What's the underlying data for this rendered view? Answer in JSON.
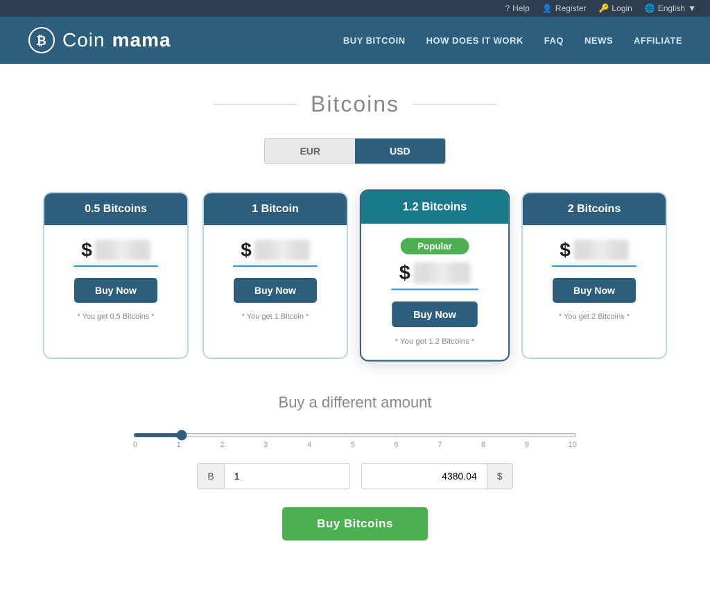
{
  "topbar": {
    "help": "Help",
    "register": "Register",
    "login": "Login",
    "language": "English"
  },
  "header": {
    "logo": "Coinmama",
    "nav": [
      "BUY BITCOIN",
      "HOW DOES IT WORK",
      "FAQ",
      "NEWS",
      "AFFILIATE"
    ]
  },
  "main": {
    "title": "Bitcoins",
    "currency_eur": "EUR",
    "currency_usd": "USD",
    "cards": [
      {
        "amount": "0.5 Bitcoins",
        "price_symbol": "$",
        "you_get": "* You get 0.5 Bitcoins *",
        "btn": "Buy Now",
        "featured": false,
        "popular": false
      },
      {
        "amount": "1 Bitcoin",
        "price_symbol": "$",
        "you_get": "* You get 1 Bitcoin *",
        "btn": "Buy Now",
        "featured": false,
        "popular": false
      },
      {
        "amount": "1.2 Bitcoins",
        "price_symbol": "$",
        "you_get": "* You get 1.2 Bitcoins *",
        "btn": "Buy Now",
        "featured": true,
        "popular": true,
        "popular_label": "Popular"
      },
      {
        "amount": "2 Bitcoins",
        "price_symbol": "$",
        "you_get": "* You get 2 Bitcoins *",
        "btn": "Buy Now",
        "featured": false,
        "popular": false
      }
    ],
    "different_amount_title": "Buy a different amount",
    "slider_labels": [
      "0",
      "1",
      "2",
      "3",
      "4",
      "5",
      "6",
      "7",
      "8",
      "9",
      "10"
    ],
    "input_btc_prefix": "B",
    "input_btc_value": "1",
    "input_usd_value": "4380.04",
    "input_usd_suffix": "$",
    "buy_btn": "Buy Bitcoins"
  }
}
